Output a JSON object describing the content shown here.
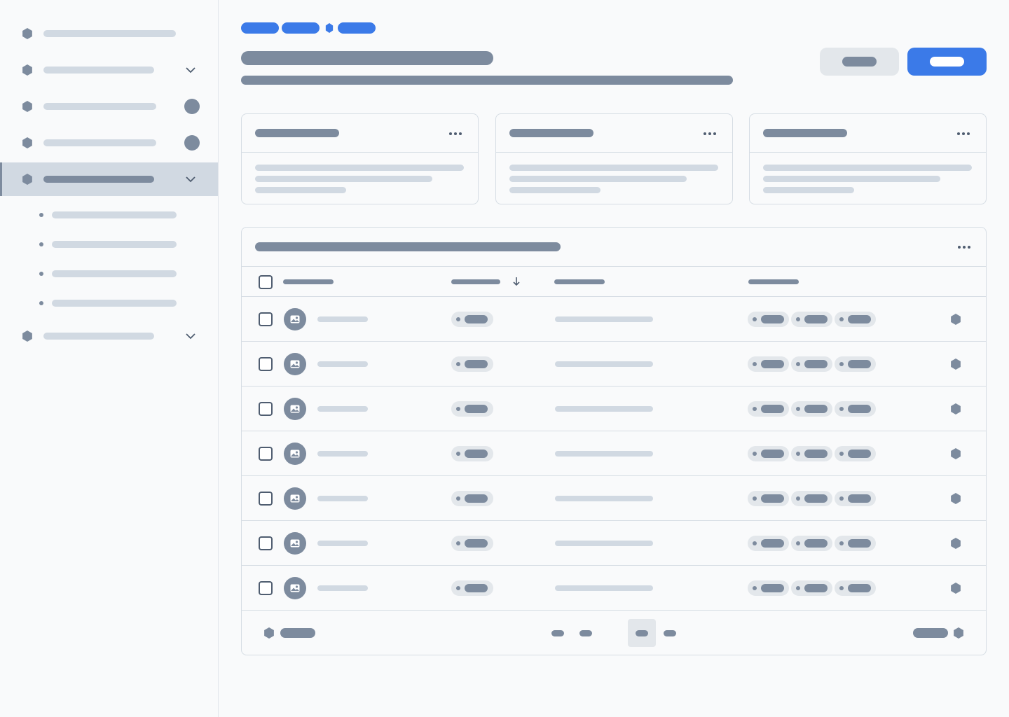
{
  "sidebar": {
    "items": [
      {
        "icon": "hexagon-icon",
        "expandable": false,
        "badge": false,
        "active": false
      },
      {
        "icon": "hexagon-icon",
        "expandable": true,
        "badge": false,
        "active": false
      },
      {
        "icon": "hexagon-icon",
        "expandable": false,
        "badge": true,
        "active": false
      },
      {
        "icon": "hexagon-icon",
        "expandable": false,
        "badge": true,
        "active": false
      },
      {
        "icon": "hexagon-icon",
        "expandable": true,
        "badge": false,
        "active": true,
        "children": 4
      },
      {
        "icon": "hexagon-icon",
        "expandable": true,
        "badge": false,
        "active": false
      }
    ]
  },
  "header": {
    "breadcrumb_separator_icon": "hexagon-icon",
    "primary_button_color": "#3b7ae8",
    "secondary_button_color": "#e3e7eb"
  },
  "cards": {
    "count": 3,
    "menu_icon": "more-horizontal-icon"
  },
  "table": {
    "menu_icon": "more-horizontal-icon",
    "sorted_column": 2,
    "sort_icon": "arrow-down-icon",
    "sort_direction": "descending",
    "row_count": 7,
    "avatar_icon": "image-icon",
    "row_action_icon": "hexagon-icon",
    "tags_per_row": 3
  },
  "pagination": {
    "pages": 4,
    "current_page": 3,
    "prev_icon": "hexagon-icon",
    "next_icon": "hexagon-icon"
  },
  "colors": {
    "accent": "#3b7ae8",
    "placeholder_dark": "#7d8b9e",
    "placeholder_light": "#d1d9e2",
    "active_nav_bg": "#d1d9e2",
    "border": "#d6dde4"
  }
}
